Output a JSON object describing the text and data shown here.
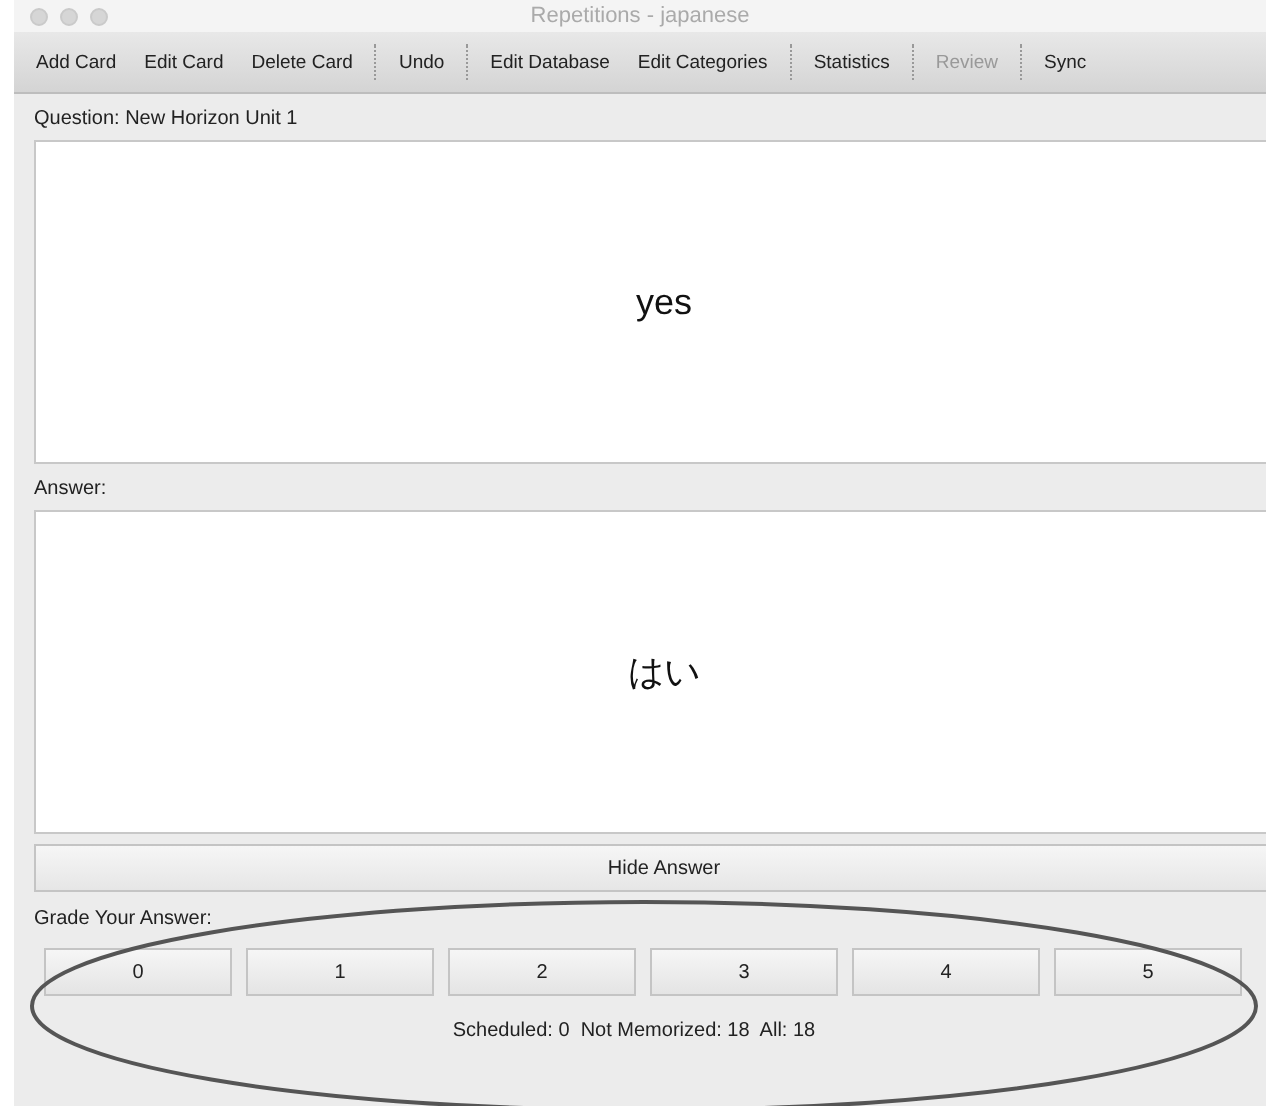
{
  "window": {
    "title": "Repetitions - japanese"
  },
  "toolbar": [
    {
      "kind": "button",
      "label": "Add Card",
      "disabled": false
    },
    {
      "kind": "button",
      "label": "Edit Card",
      "disabled": false
    },
    {
      "kind": "button",
      "label": "Delete Card",
      "disabled": false
    },
    {
      "kind": "separator"
    },
    {
      "kind": "button",
      "label": "Undo",
      "disabled": false
    },
    {
      "kind": "separator"
    },
    {
      "kind": "button",
      "label": "Edit Database",
      "disabled": false
    },
    {
      "kind": "button",
      "label": "Edit Categories",
      "disabled": false
    },
    {
      "kind": "separator"
    },
    {
      "kind": "button",
      "label": "Statistics",
      "disabled": false
    },
    {
      "kind": "separator"
    },
    {
      "kind": "button",
      "label": "Review",
      "disabled": true
    },
    {
      "kind": "separator"
    },
    {
      "kind": "button",
      "label": "Sync",
      "disabled": false
    }
  ],
  "question": {
    "label": "Question: New Horizon Unit 1",
    "text": "yes"
  },
  "answer": {
    "label": "Answer:",
    "text": "はい"
  },
  "hide_answer_button": "Hide Answer",
  "grade": {
    "label": "Grade Your Answer:",
    "buttons": [
      "0",
      "1",
      "2",
      "3",
      "4",
      "5"
    ]
  },
  "status": "Scheduled: 0  Not Memorized: 18  All: 18",
  "annotation": {
    "kind": "ellipse"
  }
}
